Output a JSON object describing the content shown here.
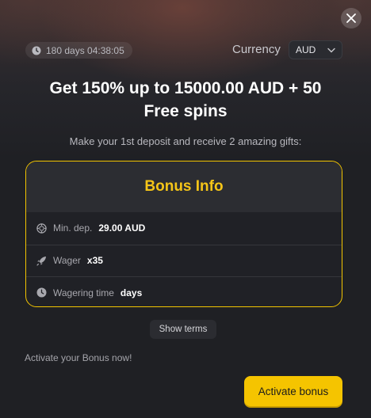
{
  "modal": {
    "timer": "180 days 04:38:05",
    "currency_label": "Currency",
    "currency_value": "AUD",
    "headline_line1": "Get 150% up to 15000.00 AUD + 50",
    "headline_line2": "Free spins",
    "subtext": "Make your 1st deposit and receive 2 amazing gifts:"
  },
  "bonus_info": {
    "title": "Bonus Info",
    "rows": [
      {
        "label": "Min. dep.",
        "value": "29.00 AUD",
        "icon": "chip-icon"
      },
      {
        "label": "Wager",
        "value": "x35",
        "icon": "rocket-icon"
      },
      {
        "label": "Wagering time",
        "value": "days",
        "icon": "clock-icon"
      }
    ]
  },
  "actions": {
    "show_terms": "Show terms",
    "activate_prompt": "Activate your Bonus now!",
    "activate_button": "Activate bonus"
  },
  "colors": {
    "accent": "#f5c400",
    "accent_text": "#f5c518",
    "background": "#1f2024"
  }
}
